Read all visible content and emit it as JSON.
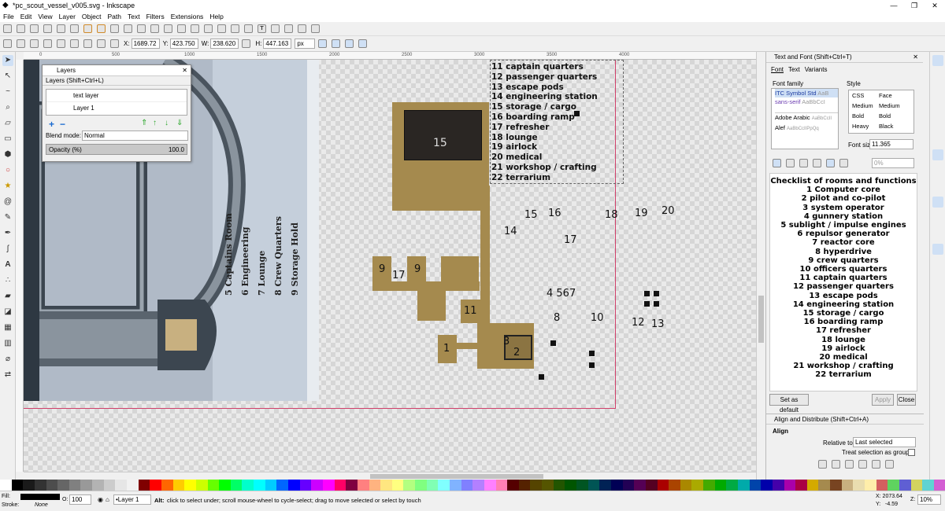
{
  "window": {
    "title": "*pc_scout_vessel_v005.svg - Inkscape",
    "min": "—",
    "max": "❐",
    "close": "✕"
  },
  "menu": [
    "File",
    "Edit",
    "View",
    "Layer",
    "Object",
    "Path",
    "Text",
    "Filters",
    "Extensions",
    "Help"
  ],
  "toolctrl": {
    "x_label": "X:",
    "x": "1689.72",
    "y_label": "Y:",
    "y": "423.750",
    "w_label": "W:",
    "w": "238.620",
    "h_label": "H:",
    "h": "447.163",
    "unit": "px"
  },
  "ruler_ticks": [
    "0",
    "500",
    "1000",
    "1500",
    "2000",
    "2500",
    "3000",
    "3500",
    "4000"
  ],
  "layers_dialog": {
    "title": "Layers",
    "tab": "Layers (Shift+Ctrl+L)",
    "layers": [
      "text layer",
      "Layer 1"
    ],
    "blend_label": "Blend mode:",
    "blend_value": "Normal",
    "opacity_label": "Opacity (%)",
    "opacity_value": "100.0"
  },
  "rotated_labels": [
    "5 Captains Room",
    "6 Engineering",
    "7 Lounge",
    "8 Crew Quarters",
    "9 Storage Hold"
  ],
  "room_list": [
    "11 captain quarters",
    "12 passenger quarters",
    "13 escape pods",
    "14 engineering station",
    "15 storage / cargo",
    "16 boarding ramp",
    "17 refresher",
    "18 lounge",
    "19 airlock",
    "20 medical",
    "21 workshop / crafting",
    "22 terrarium"
  ],
  "map_numbers": {
    "n15big": "15",
    "n15": "15",
    "n16": "16",
    "n18": "18",
    "n19": "19",
    "n20": "20",
    "n14": "14",
    "n17": "17",
    "n9a": "9",
    "n17b": "17",
    "n9b": "9",
    "n4567": "4 567",
    "n11": "11",
    "n8": "8",
    "n10": "10",
    "n12": "12",
    "n13": "13",
    "n1": "1",
    "n3": "3",
    "n2": "2"
  },
  "text_font_panel": {
    "title": "Text and Font (Shift+Ctrl+T)",
    "tabs": [
      "Font",
      "Text",
      "Variants"
    ],
    "family_label": "Font family",
    "families": [
      {
        "name": "ITC Symbol Std",
        "sample": "AaB"
      },
      {
        "name": "sans-serif",
        "sample": "AaBbCcI"
      },
      {
        "name": "Adobe Arabic",
        "sample": "AaBbCcII"
      },
      {
        "name": "Alef",
        "sample": "AaBbCcIIPpQq"
      }
    ],
    "style_label": "Style",
    "style_head": [
      "CSS",
      "Face"
    ],
    "styles": [
      [
        "Medium",
        "Medium"
      ],
      [
        "Bold",
        "Bold"
      ],
      [
        "Heavy",
        "Black"
      ]
    ],
    "size_label": "Font siz",
    "size_value": "11.365",
    "spacing": "0%",
    "preview": [
      "Checklist of rooms and functions",
      "1 Computer core",
      "2 pilot and co-pilot",
      "3 system operator",
      "4 gunnery station",
      "5 sublight / impulse engines",
      "6 repulsor generator",
      "7 reactor core",
      "8 hyperdrive",
      "9 crew quarters",
      "10 officers quarters",
      "11 captain quarters",
      "12 passenger quarters",
      "13 escape pods",
      "14 engineering station",
      "15 storage / cargo",
      "16 boarding ramp",
      "17 refresher",
      "18 lounge",
      "19 airlock",
      "20 medical",
      "21 workshop / crafting",
      "22 terrarium"
    ],
    "set_default": "Set as default",
    "apply": "Apply",
    "close": "Close"
  },
  "align_panel": {
    "title": "Align and Distribute (Shift+Ctrl+A)",
    "section": "Align",
    "relative_label": "Relative to:",
    "relative_value": "Last selected",
    "treat_group": "Treat selection as group:"
  },
  "status": {
    "fill_label": "Fill:",
    "stroke_label": "Stroke:",
    "stroke_value": "None",
    "opacity_label": "O:",
    "opacity_value": "100",
    "layer": "•Layer 1",
    "message_bold": "Alt:",
    "message": "click to select under; scroll mouse-wheel to cycle-select; drag to move selected or select by touch",
    "x": "X: 2073.64",
    "y": "Y:   -4.59",
    "z_label": "Z:",
    "zoom": "10%"
  },
  "colors": {
    "building": "#a58a4e",
    "page_border": "#d0406a",
    "accent": "#1a6bd0"
  }
}
